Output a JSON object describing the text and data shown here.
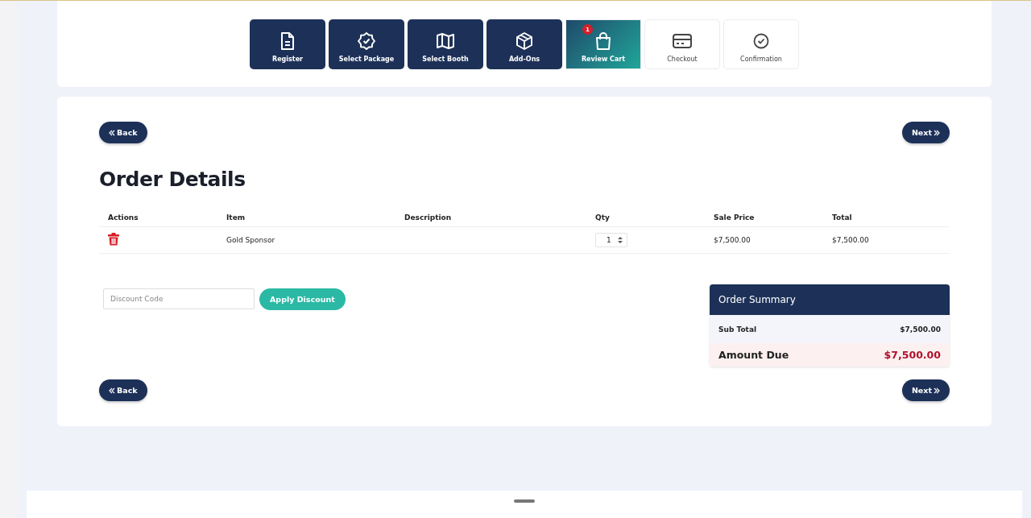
{
  "steps": [
    {
      "label": "Register",
      "kind": "document",
      "completed": true,
      "selected": false
    },
    {
      "label": "Select Package",
      "kind": "badge",
      "completed": true,
      "selected": false
    },
    {
      "label": "Select Booth",
      "kind": "map",
      "completed": true,
      "selected": false
    },
    {
      "label": "Add-Ons",
      "kind": "box",
      "completed": true,
      "selected": false
    },
    {
      "label": "Review Cart",
      "kind": "bag",
      "completed": false,
      "selected": true,
      "badge": "1"
    },
    {
      "label": "Checkout",
      "kind": "card",
      "completed": false,
      "selected": false
    },
    {
      "label": "Confirmation",
      "kind": "check",
      "completed": false,
      "selected": false
    }
  ],
  "top_nav": {
    "back": "Back",
    "next": "Next"
  },
  "title": "Order Details",
  "table": {
    "columns": [
      "Actions",
      "Item",
      "Description",
      "Qty",
      "Sale Price",
      "Total"
    ],
    "rows": [
      {
        "item": "Gold Sponsor",
        "qty": "1",
        "sale_price": "$7,500.00",
        "total": "$7,500.00"
      }
    ]
  },
  "discount": {
    "placeholder": "Discount Code",
    "button": "Apply Discount"
  },
  "summary": {
    "title": "Order Summary",
    "sub_total_label": "Sub Total",
    "sub_total": "$7,500.00",
    "amount_due_label": "Amount Due",
    "amount_due": "$7,500.00"
  },
  "bottom_nav": {
    "back": "Back",
    "next": "Next"
  }
}
